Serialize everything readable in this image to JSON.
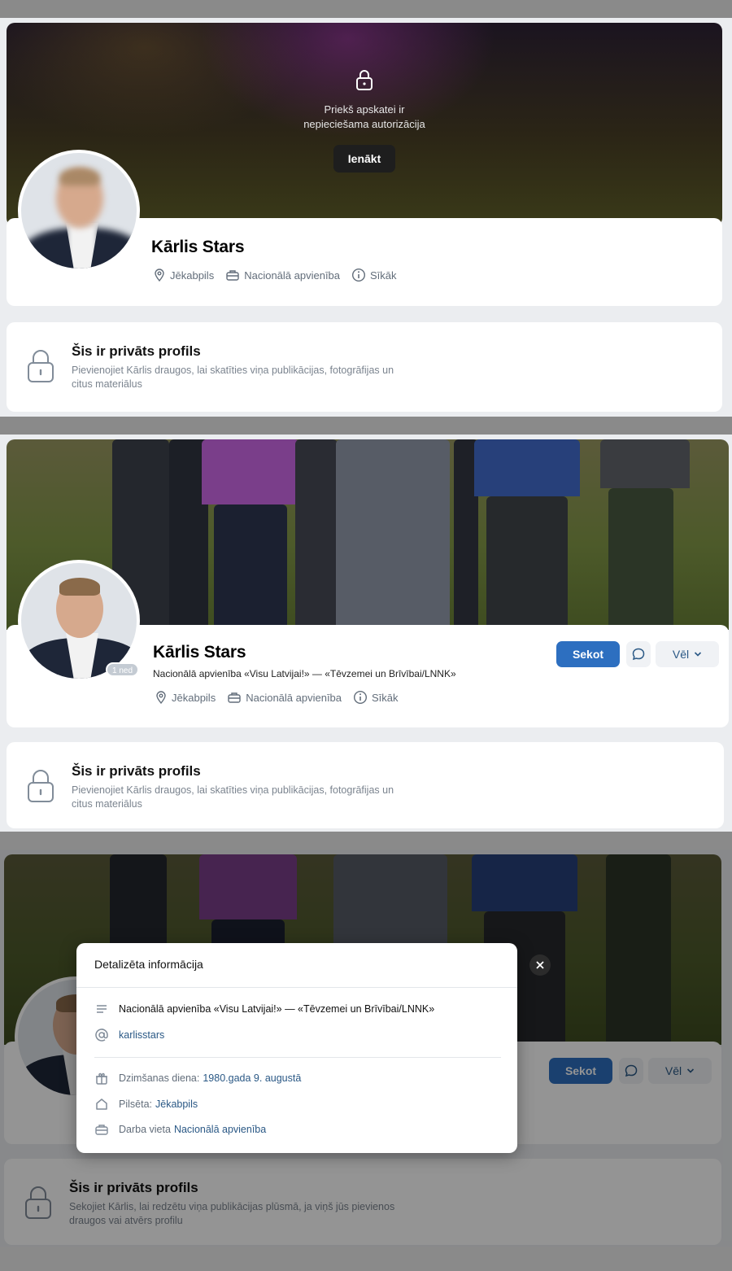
{
  "profile": {
    "name": "Kārlis Stars",
    "tagline": "Nacionālā apvienība «Visu Latvijai!» — «Tēvzemei un Brīvībai/LNNK»",
    "city": "Jēkabpils",
    "work": "Nacionālā apvienība",
    "details_link": "Sīkāk",
    "age_badge": "1 ned"
  },
  "locked_cover": {
    "message_line1": "Priekš apskatei ir",
    "message_line2": "nepieciešama autorizācija",
    "login_label": "Ienākt"
  },
  "private_profile": {
    "title": "Šis ir privāts profils",
    "description": "Pievienojiet Kārlis draugos, lai skatīties viņa publikācijas, fotogrāfijas un citus materiālus",
    "description_alt": "Sekojiet Kārlis, lai redzētu viņa publikācijas plūsmā, ja viņš jūs pievienos draugos vai atvērs profilu"
  },
  "actions": {
    "follow_label": "Sekot",
    "more_label": "Vēl"
  },
  "details_modal": {
    "title": "Detalizēta informācija",
    "about": "Nacionālā apvienība «Visu Latvijai!» — «Tēvzemei un Brīvībai/LNNK»",
    "username": "karlisstars",
    "birthday_label": "Dzimšanas diena:",
    "birthday_value": "1980.gada 9. augustā",
    "city_label": "Pilsēta:",
    "city_value": "Jēkabpils",
    "work_label": "Darba vieta",
    "work_value": "Nacionālā apvienība"
  },
  "colors": {
    "accent": "#2d6fc0",
    "link": "#2a5885",
    "muted": "#626d7a"
  }
}
